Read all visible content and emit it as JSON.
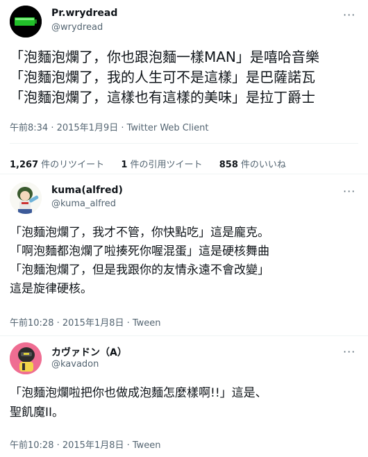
{
  "tweets": [
    {
      "name": "Pr.wrydread",
      "handle": "@wrydread",
      "lines": [
        "「泡麵泡爛了，你也跟泡麵一樣MAN」是嘻哈音樂",
        "「泡麵泡爛了，我的人生可不是這樣」是巴薩諾瓦",
        "「泡麵泡爛了，這樣也有這樣的美味」是拉丁爵士"
      ],
      "meta": "午前8:34 · 2015年1月9日 · Twitter Web Client",
      "stats": {
        "retweets_count": "1,267",
        "retweets_label": "件のリツイート",
        "quotes_count": "1",
        "quotes_label": "件の引用ツイート",
        "likes_count": "858",
        "likes_label": "件のいいね"
      }
    },
    {
      "name": "kuma(alfred)",
      "handle": "@kuma_alfred",
      "lines": [
        "「泡麵泡爛了，我才不管，你快點吃」這是龐克。",
        "「啊泡麵都泡爛了啦揍死你喔混蛋」這是硬核舞曲",
        "「泡麵泡爛了，但是我跟你的友情永遠不會改變」",
        "這是旋律硬核。"
      ],
      "meta": "午前10:28 · 2015年1月8日 · Tween"
    },
    {
      "name": "カヴァドン（A）",
      "handle": "@kavadon",
      "lines": [
        "「泡麵泡爛啦把你也做成泡麵怎麼樣啊!!」這是、",
        "聖飢魔II。"
      ],
      "meta": "午前10:28 · 2015年1月8日 · Tween"
    }
  ],
  "more_label": "···",
  "icons": [
    "battery-avatar-icon",
    "anime-girl-avatar-icon",
    "helmet-avatar-icon",
    "more-icon"
  ]
}
